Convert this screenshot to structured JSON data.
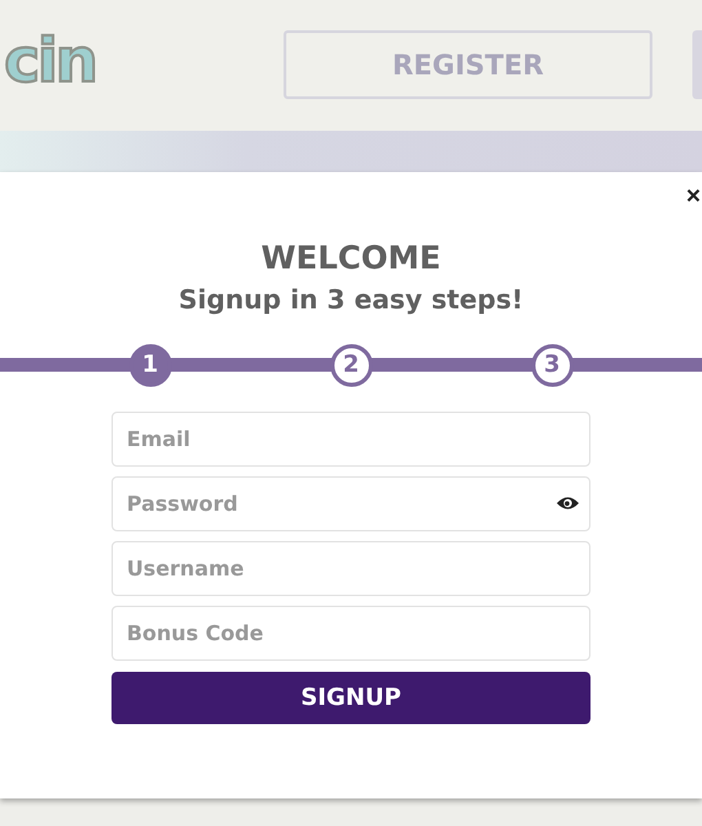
{
  "header": {
    "logo": "cin",
    "register_button": "REGISTER"
  },
  "modal": {
    "close": "×",
    "title": "WELCOME",
    "subtitle": "Signup in 3 easy steps!",
    "steps": [
      {
        "label": "1",
        "selected": true
      },
      {
        "label": "2",
        "selected": false
      },
      {
        "label": "3",
        "selected": false
      }
    ],
    "fields": [
      {
        "placeholder": "Email",
        "kind": "text"
      },
      {
        "placeholder": "Password",
        "kind": "password"
      },
      {
        "placeholder": "Username",
        "kind": "text"
      },
      {
        "placeholder": "Bonus Code",
        "kind": "text"
      }
    ],
    "submit": "SIGNUP"
  }
}
